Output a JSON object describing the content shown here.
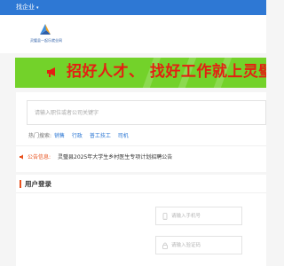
{
  "topbar": {
    "menu_label": "找企业",
    "caret": "▾"
  },
  "logo": {
    "caption": "灵璧县一起乐就业网"
  },
  "banner": {
    "slogan": "招好人才、 找好工作就上灵璧聚一起"
  },
  "search": {
    "placeholder": "请输入职位或者公司关键字"
  },
  "hot": {
    "label": "热门搜索:",
    "keywords": [
      "销售",
      "行政",
      "普工技工",
      "司机"
    ]
  },
  "notice": {
    "label": "公告信息:",
    "text": "灵璧县2025年大学生乡村医生专项计划招聘公告"
  },
  "login": {
    "title": "用户登录",
    "phone_placeholder": "请输入手机号",
    "code_placeholder": "请输入验证码"
  },
  "colors": {
    "brand_blue": "#2e78d4",
    "banner_green": "#73d22a",
    "slogan_red": "#e41f12",
    "accent_orange": "#e8521e"
  }
}
